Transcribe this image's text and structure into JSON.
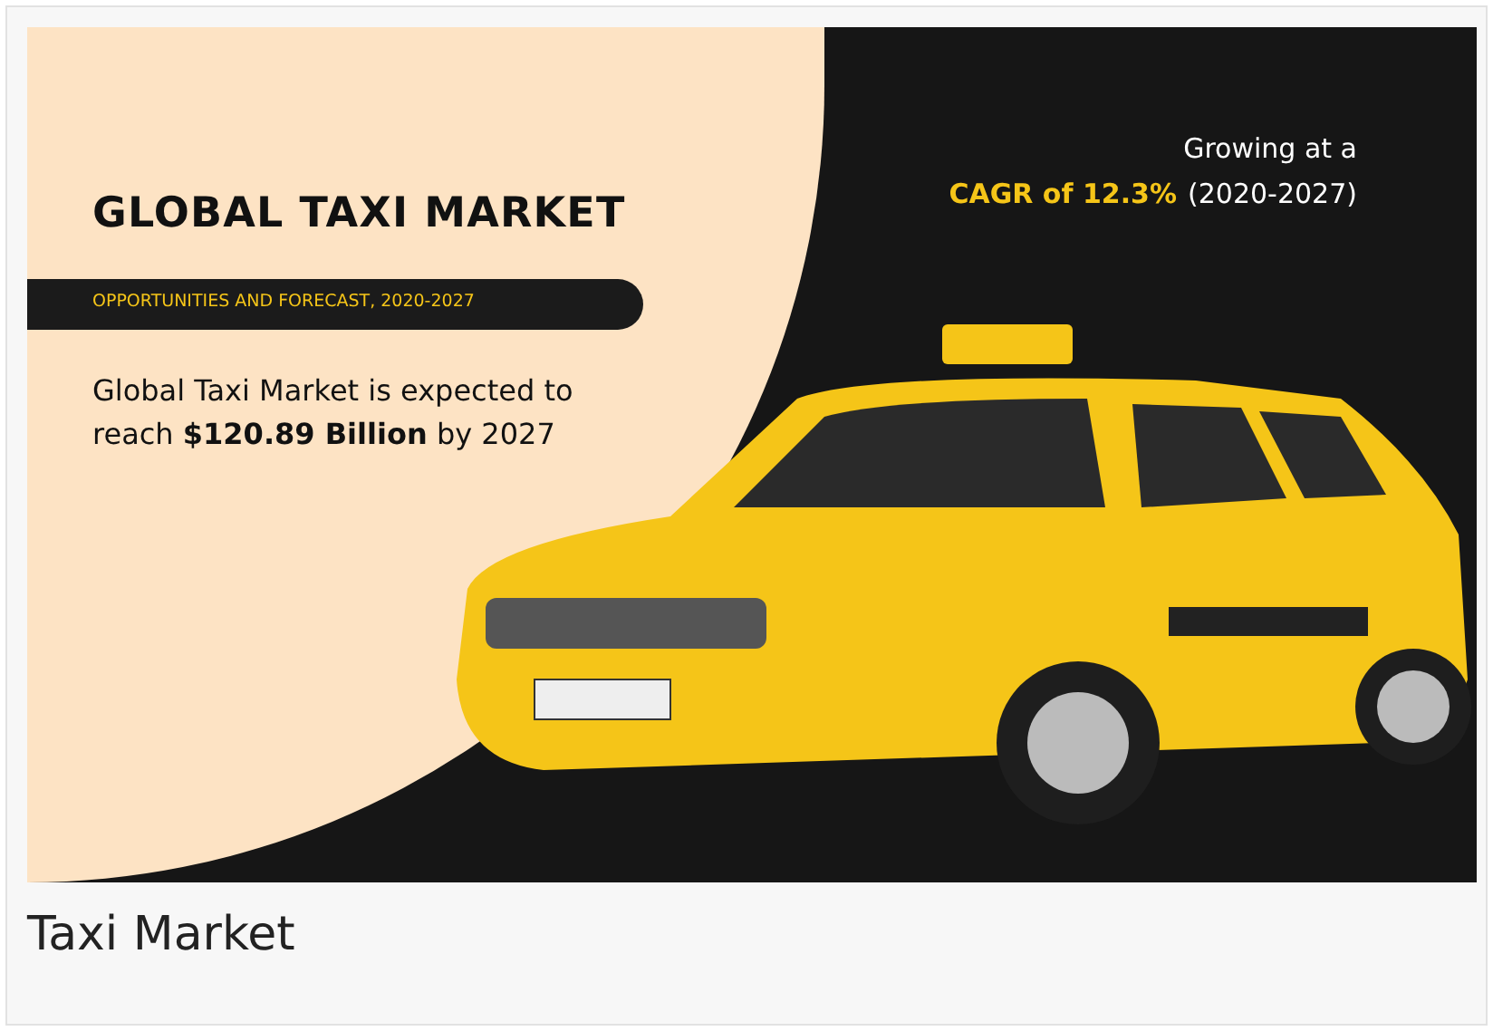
{
  "infographic": {
    "title": "GLOBAL TAXI MARKET",
    "subtitle": "OPPORTUNITIES AND FORECAST, 2020-2027",
    "description": "Global Taxi Market is expected to reach **$120.89 Billion** by 2027",
    "growth_line": "Growing at a",
    "growth_highlight": "CAGR of 12.3%",
    "growth_period": "(2020-2027)"
  },
  "caption": "Taxi Market"
}
